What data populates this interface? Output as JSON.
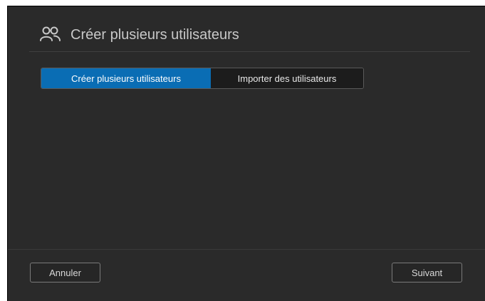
{
  "dialog": {
    "title": "Créer plusieurs utilisateurs",
    "title_icon": "users-icon"
  },
  "tabs": [
    {
      "label": "Créer plusieurs utilisateurs",
      "active": true
    },
    {
      "label": "Importer des utilisateurs",
      "active": false
    }
  ],
  "footer": {
    "cancel_label": "Annuler",
    "next_label": "Suivant"
  },
  "colors": {
    "dialog_background": "#2a2a2a",
    "accent": "#0a6db4",
    "text": "#c8c8c8"
  }
}
